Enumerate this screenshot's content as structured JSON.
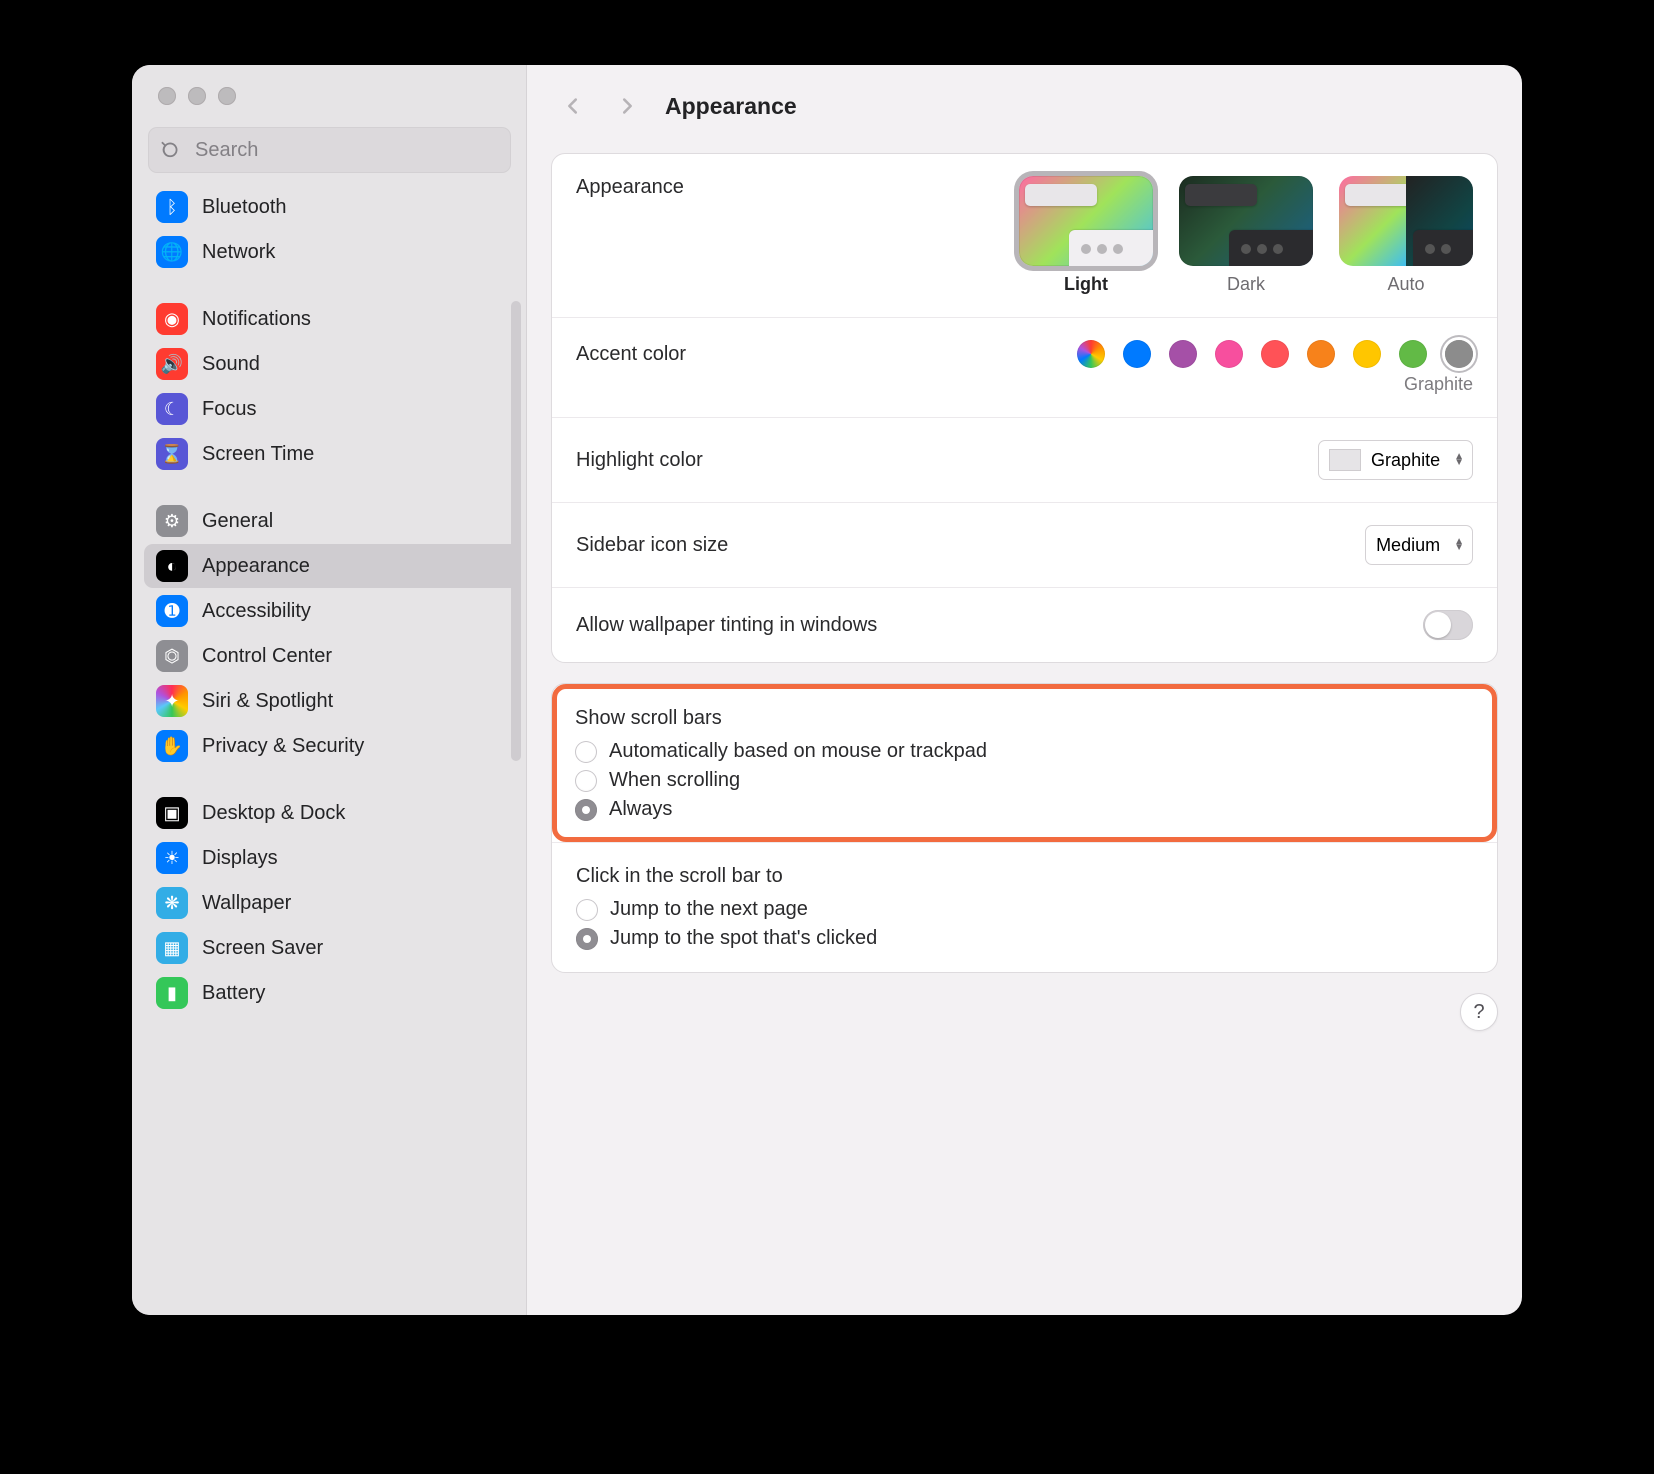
{
  "window": {
    "title": "Appearance"
  },
  "search": {
    "placeholder": "Search"
  },
  "sidebar": {
    "items": [
      {
        "label": "Bluetooth",
        "icon": "bluetooth",
        "color": "blue"
      },
      {
        "label": "Network",
        "icon": "network",
        "color": "blue"
      },
      {
        "spacer": true
      },
      {
        "label": "Notifications",
        "icon": "bell",
        "color": "red"
      },
      {
        "label": "Sound",
        "icon": "speaker",
        "color": "red"
      },
      {
        "label": "Focus",
        "icon": "moon",
        "color": "purple"
      },
      {
        "label": "Screen Time",
        "icon": "hourglass",
        "color": "purple"
      },
      {
        "spacer": true
      },
      {
        "label": "General",
        "icon": "gear",
        "color": "grey"
      },
      {
        "label": "Appearance",
        "icon": "contrast",
        "color": "black",
        "selected": true
      },
      {
        "label": "Accessibility",
        "icon": "accessibility",
        "color": "blue"
      },
      {
        "label": "Control Center",
        "icon": "switches",
        "color": "grey"
      },
      {
        "label": "Siri & Spotlight",
        "icon": "siri",
        "color": "siri"
      },
      {
        "label": "Privacy & Security",
        "icon": "hand",
        "color": "blue"
      },
      {
        "spacer": true
      },
      {
        "label": "Desktop & Dock",
        "icon": "dock",
        "color": "black"
      },
      {
        "label": "Displays",
        "icon": "sun",
        "color": "blue"
      },
      {
        "label": "Wallpaper",
        "icon": "flower",
        "color": "teal"
      },
      {
        "label": "Screen Saver",
        "icon": "screensaver",
        "color": "teal"
      },
      {
        "label": "Battery",
        "icon": "battery",
        "color": "green"
      }
    ]
  },
  "appearance": {
    "section_label": "Appearance",
    "themes": [
      {
        "label": "Light",
        "selected": true,
        "variant": "light"
      },
      {
        "label": "Dark",
        "variant": "dark"
      },
      {
        "label": "Auto",
        "variant": "auto"
      }
    ],
    "accent": {
      "label": "Accent color",
      "swatches": [
        "multicolor",
        "#007aff",
        "#a550a7",
        "#f74f9e",
        "#ff5257",
        "#f7821b",
        "#ffc600",
        "#62ba46",
        "#8c8c8c"
      ],
      "selected_index": 8,
      "selected_label": "Graphite"
    },
    "highlight": {
      "label": "Highlight color",
      "value": "Graphite"
    },
    "sidebar_icon": {
      "label": "Sidebar icon size",
      "value": "Medium"
    },
    "wallpaper_tint": {
      "label": "Allow wallpaper tinting in windows",
      "on": false
    },
    "scroll_bars": {
      "label": "Show scroll bars",
      "options": [
        {
          "label": "Automatically based on mouse or trackpad",
          "checked": false
        },
        {
          "label": "When scrolling",
          "checked": false
        },
        {
          "label": "Always",
          "checked": true
        }
      ]
    },
    "click_scroll": {
      "label": "Click in the scroll bar to",
      "options": [
        {
          "label": "Jump to the next page",
          "checked": false
        },
        {
          "label": "Jump to the spot that's clicked",
          "checked": true
        }
      ]
    }
  },
  "icons": {
    "bluetooth": "ᛒ",
    "network": "🌐",
    "bell": "◉",
    "speaker": "🔊",
    "moon": "☾",
    "hourglass": "⌛",
    "gear": "⚙",
    "contrast": "◐",
    "accessibility": "➊",
    "switches": "⏣",
    "siri": "✦",
    "hand": "✋",
    "dock": "▣",
    "sun": "☀",
    "flower": "❋",
    "screensaver": "▦",
    "battery": "▮"
  }
}
